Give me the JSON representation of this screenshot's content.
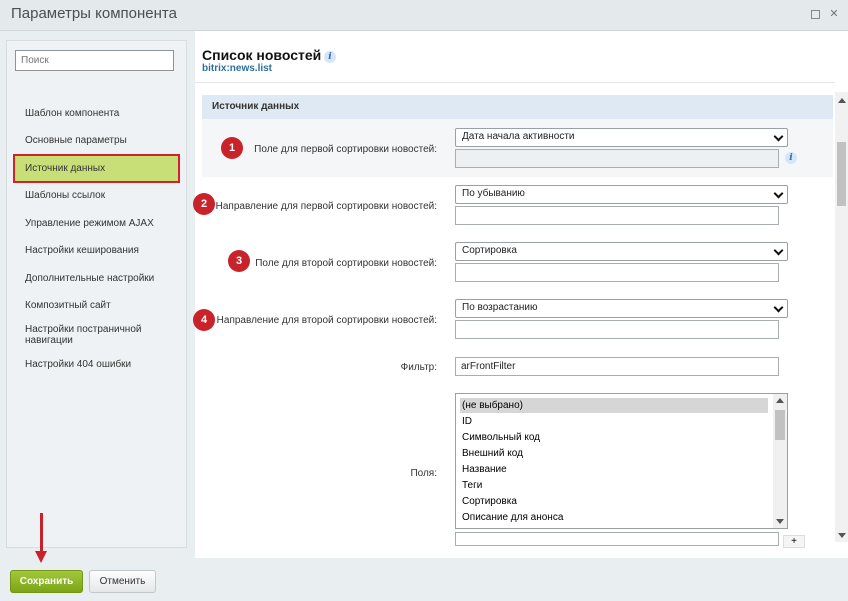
{
  "window": {
    "title": "Параметры компонента"
  },
  "search": {
    "placeholder": "Поиск"
  },
  "nav": {
    "items": [
      "Шаблон компонента",
      "Основные параметры",
      "Источник данных",
      "Шаблоны ссылок",
      "Управление режимом AJAX",
      "Настройки кеширования",
      "Дополнительные настройки",
      "Композитный сайт",
      "Настройки постраничной навигации",
      "Настройки 404 ошибки"
    ],
    "active_index": 2
  },
  "component": {
    "title": "Список новостей",
    "code": "bitrix:news.list"
  },
  "section": {
    "title": "Источник данных"
  },
  "fields": {
    "sort_by1": {
      "badge": "1",
      "label": "Поле для первой сортировки новостей:",
      "value": "Дата начала активности"
    },
    "sort_order1": {
      "badge": "2",
      "label": "Направление для первой сортировки новостей:",
      "value": "По убыванию"
    },
    "sort_by2": {
      "badge": "3",
      "label": "Поле для второй сортировки новостей:",
      "value": "Сортировка"
    },
    "sort_order2": {
      "badge": "4",
      "label": "Направление для второй сортировки новостей:",
      "value": "По возрастанию"
    },
    "filter": {
      "label": "Фильтр:",
      "value": "arFrontFilter"
    },
    "fields_list": {
      "label": "Поля:",
      "options": [
        "(не выбрано)",
        "ID",
        "Символьный код",
        "Внешний код",
        "Название",
        "Теги",
        "Сортировка",
        "Описание для анонса"
      ],
      "selected": "(не выбрано)"
    },
    "add_button": "+"
  },
  "icons": {
    "info": "info-icon",
    "minimize": "minimize-icon",
    "close": "close-icon"
  },
  "colors": {
    "accent_red": "#c8222a",
    "active_green": "#c7df76",
    "save_green": "#7aa516"
  },
  "footer": {
    "save_label": "Сохранить",
    "cancel_label": "Отменить"
  }
}
